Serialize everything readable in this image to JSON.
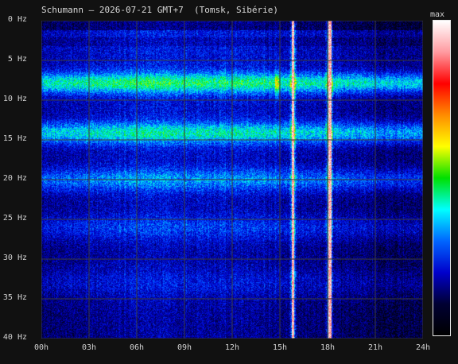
{
  "title": "Schumann – 2026-07-21 GMT+7  (Tomsk, Sibérie)",
  "colorbar": {
    "label": "max",
    "stops": [
      "#ffffff",
      "#ff9aa0",
      "#ff0000",
      "#ff8c00",
      "#ffff00",
      "#00e000",
      "#00ffff",
      "#0066ff",
      "#0000cc",
      "#000033",
      "#000000"
    ]
  },
  "chart_data": {
    "type": "heatmap",
    "title": "Schumann – 2026-07-21 GMT+7  (Tomsk, Sibérie)",
    "xlabel": "",
    "ylabel": "",
    "x_ticks": [
      "00h",
      "03h",
      "06h",
      "09h",
      "12h",
      "15h",
      "18h",
      "21h",
      "24h"
    ],
    "y_ticks": [
      "0 Hz",
      "5 Hz",
      "10 Hz",
      "15 Hz",
      "20 Hz",
      "25 Hz",
      "30 Hz",
      "35 Hz",
      "40 Hz"
    ],
    "xlim_hours": [
      0,
      24
    ],
    "ylim_hz": [
      0,
      40
    ],
    "grid": true,
    "resonance_bands_hz": [
      7.8,
      14.1,
      20.0,
      26.0,
      33.0
    ],
    "saturation_events_hours": [
      15.8,
      18.1
    ],
    "colorscale_max_label": "max"
  }
}
